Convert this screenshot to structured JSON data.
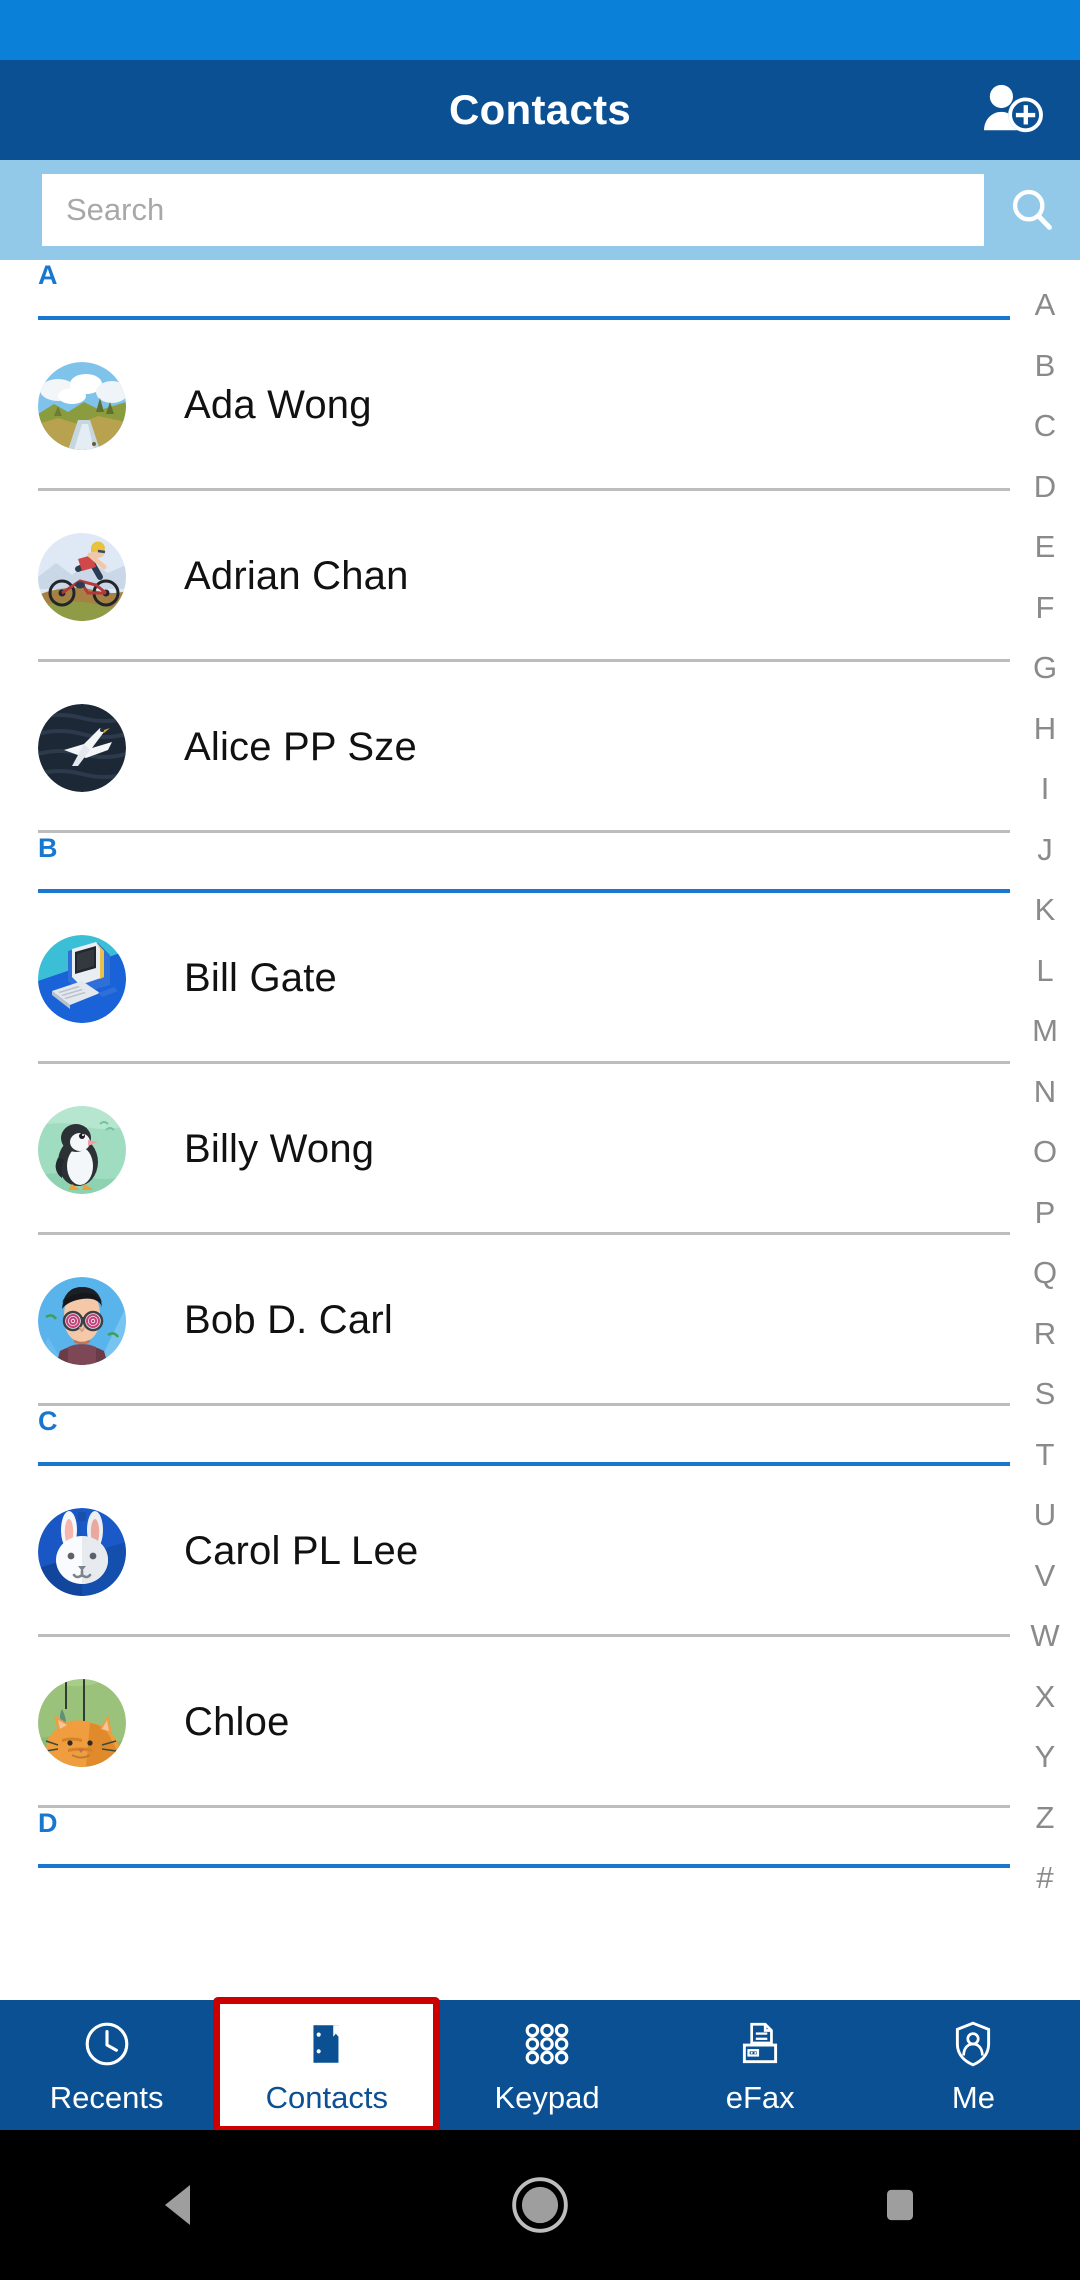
{
  "app": {
    "title": "Contacts",
    "add_contact_icon": "add-person-icon"
  },
  "search": {
    "placeholder": "Search",
    "value": "",
    "icon": "search-icon"
  },
  "contacts": {
    "sections": [
      {
        "letter": "A",
        "items": [
          {
            "name": "Ada Wong",
            "avatar": "landscape-river"
          },
          {
            "name": "Adrian Chan",
            "avatar": "cyclist"
          },
          {
            "name": "Alice PP Sze",
            "avatar": "seabird"
          }
        ]
      },
      {
        "letter": "B",
        "items": [
          {
            "name": "Bill Gate",
            "avatar": "retro-computer"
          },
          {
            "name": "Billy Wong",
            "avatar": "penguin"
          },
          {
            "name": "Bob D. Carl",
            "avatar": "man-spiral-glasses"
          }
        ]
      },
      {
        "letter": "C",
        "items": [
          {
            "name": "Carol PL Lee",
            "avatar": "white-rabbit"
          },
          {
            "name": "Chloe",
            "avatar": "orange-cat"
          }
        ]
      },
      {
        "letter": "D",
        "items": []
      }
    ]
  },
  "alpha_index": [
    "A",
    "B",
    "C",
    "D",
    "E",
    "F",
    "G",
    "H",
    "I",
    "J",
    "K",
    "L",
    "M",
    "N",
    "O",
    "P",
    "Q",
    "R",
    "S",
    "T",
    "U",
    "V",
    "W",
    "X",
    "Y",
    "Z",
    "#"
  ],
  "bottom_nav": {
    "items": [
      {
        "label": "Recents",
        "icon": "clock-icon",
        "active": false
      },
      {
        "label": "Contacts",
        "icon": "addressbook-icon",
        "active": true
      },
      {
        "label": "Keypad",
        "icon": "keypad-icon",
        "active": false
      },
      {
        "label": "eFax",
        "icon": "fax-icon",
        "active": false
      },
      {
        "label": "Me",
        "icon": "shield-person-icon",
        "active": false
      }
    ]
  },
  "system_nav": {
    "back": "back-triangle-icon",
    "home": "home-circle-icon",
    "recents": "recents-square-icon"
  },
  "colors": {
    "status_strip": "#0b80d8",
    "appbar": "#0a5093",
    "search_bg": "#93c9e8",
    "section_accent": "#1878cf",
    "active_border": "#cc0000"
  }
}
